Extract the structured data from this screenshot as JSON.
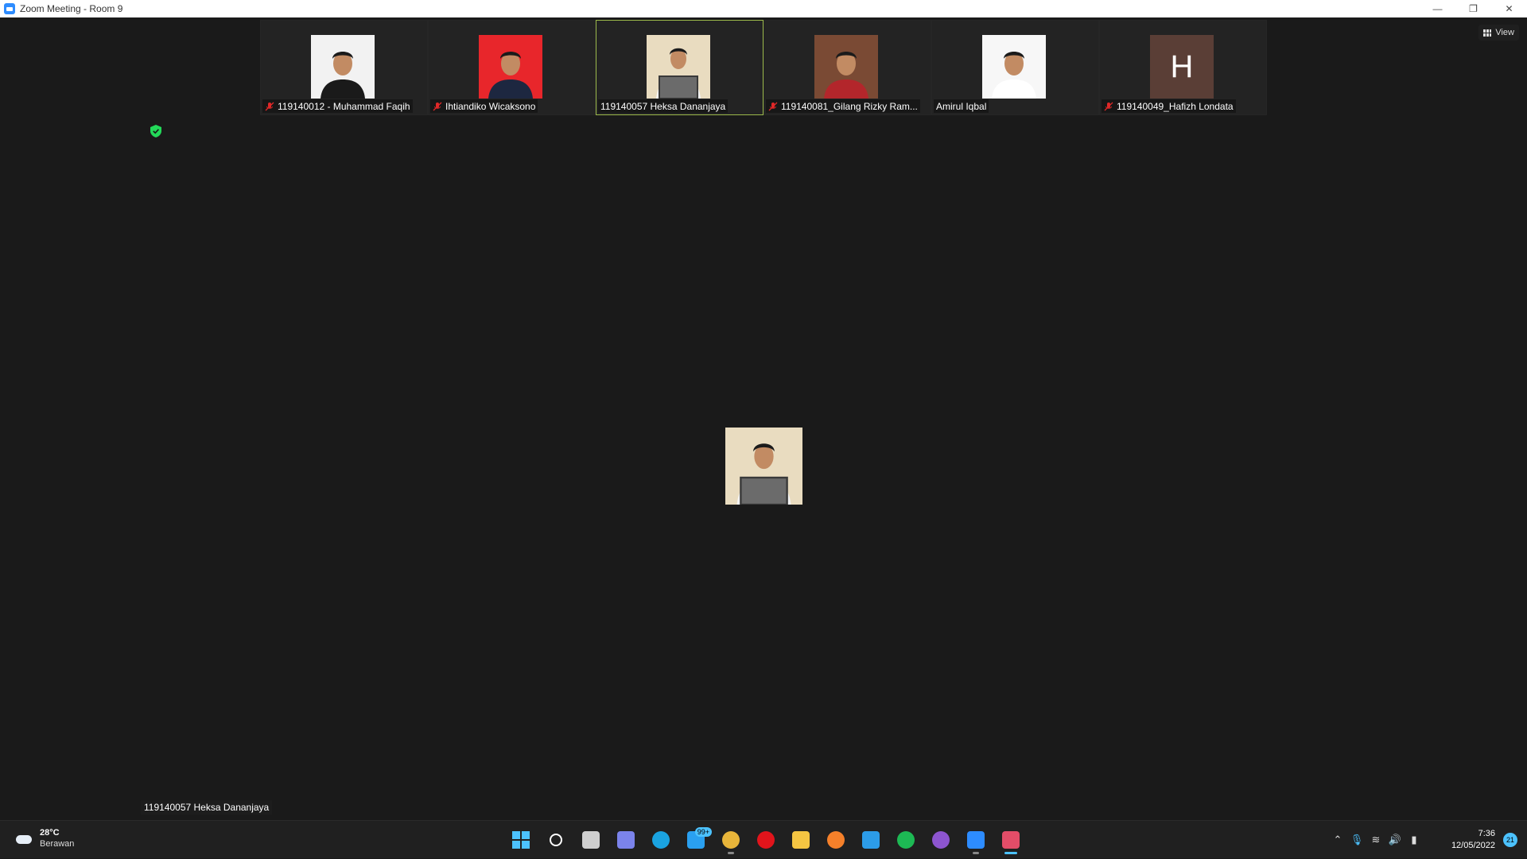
{
  "window": {
    "title": "Zoom Meeting - Room 9"
  },
  "meeting": {
    "view_label": "View",
    "participants": [
      {
        "name": "119140012 - Muhammad Faqih",
        "muted": true,
        "avatar": "photo",
        "bg": "#f2f2f2"
      },
      {
        "name": "Ihtiandiko Wicaksono",
        "muted": true,
        "avatar": "photo",
        "bg": "#e8262b"
      },
      {
        "name": "119140057 Heksa Dananjaya",
        "muted": false,
        "avatar": "photo",
        "bg": "#e9dcc0",
        "active": true
      },
      {
        "name": "119140081_Gilang Rizky Ram...",
        "muted": true,
        "avatar": "photo",
        "bg": "#7a4a34"
      },
      {
        "name": "Amirul Iqbal",
        "muted": false,
        "avatar": "photo",
        "bg": "#f7f7f7"
      },
      {
        "name": "119140049_Hafizh Londata",
        "muted": true,
        "avatar": "initial",
        "initial": "H",
        "bg": "#5a3e36"
      }
    ],
    "active_speaker_label": "119140057 Heksa Dananjaya"
  },
  "taskbar": {
    "weather": {
      "temp": "28°C",
      "condition": "Berawan"
    },
    "apps": [
      {
        "name": "start",
        "color": "#4cc2ff"
      },
      {
        "name": "search",
        "color": "#ffffff"
      },
      {
        "name": "task-view",
        "color": "#cfcfcf"
      },
      {
        "name": "chat",
        "color": "#7b83eb"
      },
      {
        "name": "edge",
        "color": "#1aa3e0"
      },
      {
        "name": "mail",
        "color": "#2aa0f0",
        "badge": "99+"
      },
      {
        "name": "chrome",
        "color": "#e8b53a",
        "running": true
      },
      {
        "name": "opera",
        "color": "#e1141b"
      },
      {
        "name": "file-explorer",
        "color": "#f5c542"
      },
      {
        "name": "firefox",
        "color": "#f5802a"
      },
      {
        "name": "vscode",
        "color": "#2c9ce8"
      },
      {
        "name": "spotify",
        "color": "#1db954"
      },
      {
        "name": "github-desktop",
        "color": "#8d55cf"
      },
      {
        "name": "zoom",
        "color": "#2d8cff",
        "running": true
      },
      {
        "name": "snipping-tool",
        "color": "#e34d68",
        "running": true,
        "active": true
      }
    ],
    "clock": {
      "time": "7:36",
      "date": "12/05/2022"
    },
    "notifications": "21"
  }
}
